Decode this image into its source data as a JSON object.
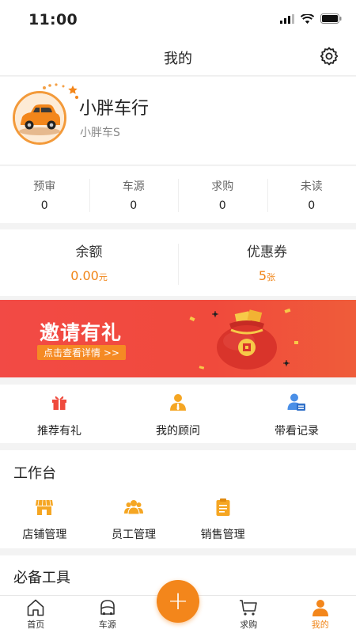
{
  "status_bar": {
    "time": "11:00"
  },
  "nav": {
    "title": "我的",
    "settings_icon": "gear-icon"
  },
  "profile": {
    "name": "小胖车行",
    "subtitle": "小胖车S"
  },
  "stats": [
    {
      "label": "预审",
      "value": "0"
    },
    {
      "label": "车源",
      "value": "0"
    },
    {
      "label": "求购",
      "value": "0"
    },
    {
      "label": "未读",
      "value": "0"
    }
  ],
  "wallet": {
    "balance_label": "余额",
    "balance_value": "0.00",
    "balance_unit": "元",
    "coupon_label": "优惠券",
    "coupon_value": "5",
    "coupon_unit": "张"
  },
  "banner": {
    "title": "邀请有礼",
    "button": "点击查看详情 >>"
  },
  "quick_actions": [
    {
      "label": "推荐有礼",
      "icon": "gift-icon"
    },
    {
      "label": "我的顾问",
      "icon": "advisor-icon"
    },
    {
      "label": "带看记录",
      "icon": "record-icon"
    }
  ],
  "workbench": {
    "title": "工作台",
    "items": [
      {
        "label": "店铺管理",
        "icon": "store-icon"
      },
      {
        "label": "员工管理",
        "icon": "staff-icon"
      },
      {
        "label": "销售管理",
        "icon": "clipboard-icon"
      }
    ]
  },
  "tools": {
    "title": "必备工具"
  },
  "tabbar": [
    {
      "label": "首页",
      "icon": "home-icon"
    },
    {
      "label": "车源",
      "icon": "car-icon"
    },
    {
      "label": "求购",
      "icon": "cart-icon"
    },
    {
      "label": "我的",
      "icon": "user-icon"
    }
  ],
  "colors": {
    "accent": "#f08518",
    "banner": "#f24a45"
  }
}
